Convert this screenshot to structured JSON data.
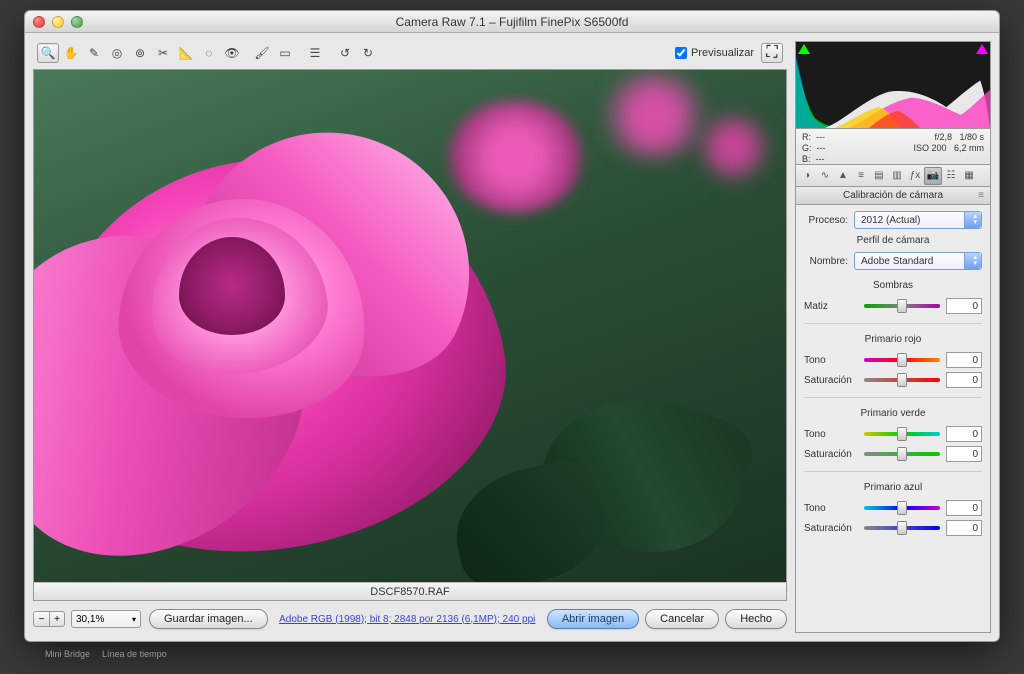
{
  "window": {
    "title": "Camera Raw 7.1  –  Fujifilm FinePix S6500fd"
  },
  "toolbar": {
    "preview_label": "Previsualizar",
    "preview_checked": true
  },
  "image": {
    "filename": "DSCF8570.RAF",
    "zoom": "30,1%"
  },
  "footer": {
    "save_label": "Guardar imagen...",
    "link_text": "Adobe RGB (1998); bit 8; 2848 por 2136 (6,1MP); 240 ppi",
    "open_label": "Abrir imagen",
    "cancel_label": "Cancelar",
    "done_label": "Hecho"
  },
  "meta": {
    "r_label": "R:",
    "g_label": "G:",
    "b_label": "B:",
    "r_val": "---",
    "g_val": "---",
    "b_val": "---",
    "aperture": "f/2,8",
    "shutter": "1/80 s",
    "iso": "ISO 200",
    "focal": "6,2 mm"
  },
  "panel": {
    "header": "Calibración de cámara",
    "process_label": "Proceso:",
    "process_value": "2012 (Actual)",
    "profile_header": "Perfil de cámara",
    "name_label": "Nombre:",
    "name_value": "Adobe Standard"
  },
  "groups": {
    "shadows": {
      "title": "Sombras",
      "hue_label": "Matiz",
      "hue_value": "0"
    },
    "red": {
      "title": "Primario rojo",
      "hue_label": "Tono",
      "hue_value": "0",
      "sat_label": "Saturación",
      "sat_value": "0"
    },
    "green": {
      "title": "Primario verde",
      "hue_label": "Tono",
      "hue_value": "0",
      "sat_label": "Saturación",
      "sat_value": "0"
    },
    "blue": {
      "title": "Primario azul",
      "hue_label": "Tono",
      "hue_value": "0",
      "sat_label": "Saturación",
      "sat_value": "0"
    }
  },
  "statusbar": {
    "item1": "Mini Bridge",
    "item2": "Línea de tiempo"
  }
}
